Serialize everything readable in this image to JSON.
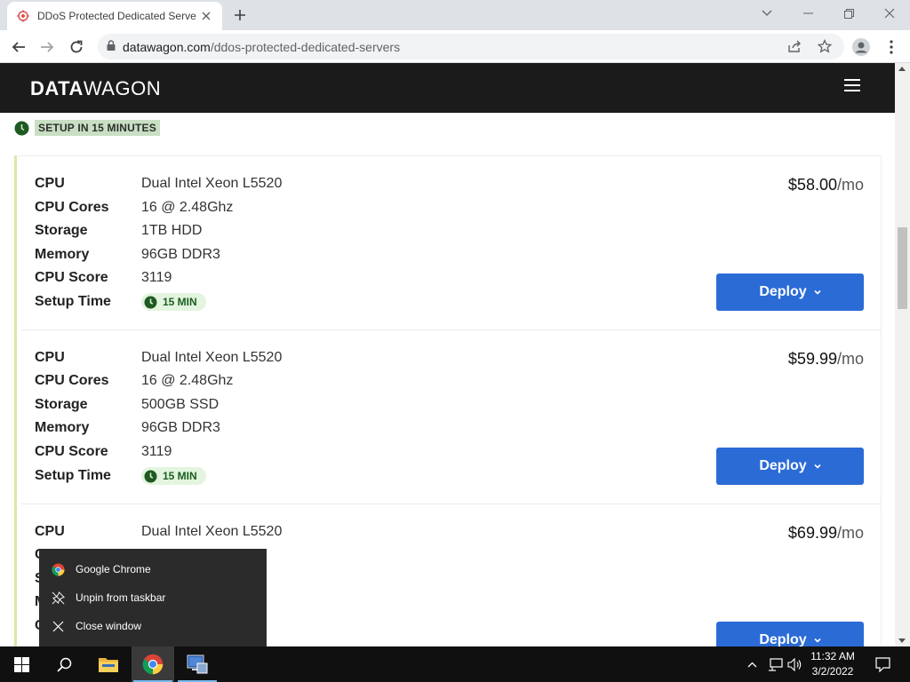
{
  "browser": {
    "tab_title": "DDoS Protected Dedicated Serve",
    "url_domain": "datawagon.com",
    "url_path": "/ddos-protected-dedicated-servers"
  },
  "site": {
    "logo_bold": "DATA",
    "logo_light": "WAGON",
    "setup_badge": "SETUP IN 15 MINUTES"
  },
  "labels": {
    "cpu": "CPU",
    "cores": "CPU Cores",
    "storage": "Storage",
    "memory": "Memory",
    "score": "CPU Score",
    "setup": "Setup Time",
    "deploy": "Deploy",
    "per_month": "/mo"
  },
  "servers": [
    {
      "cpu": "Dual Intel Xeon L5520",
      "cores": "16 @ 2.48Ghz",
      "storage": "1TB HDD",
      "memory": "96GB DDR3",
      "score": "3119",
      "setup": "15 MIN",
      "price": "$58.00"
    },
    {
      "cpu": "Dual Intel Xeon L5520",
      "cores": "16 @ 2.48Ghz",
      "storage": "500GB SSD",
      "memory": "96GB DDR3",
      "score": "3119",
      "setup": "15 MIN",
      "price": "$59.99"
    },
    {
      "cpu": "Dual Intel Xeon L5520",
      "price": "$69.99"
    }
  ],
  "context_menu": {
    "items": [
      {
        "label": "Google Chrome",
        "icon": "chrome-icon"
      },
      {
        "label": "Unpin from taskbar",
        "icon": "unpin-icon"
      },
      {
        "label": "Close window",
        "icon": "close-icon"
      }
    ]
  },
  "taskbar": {
    "time": "11:32 AM",
    "date": "3/2/2022"
  },
  "colors": {
    "accent": "#2b6bd6",
    "header": "#1b1b1b",
    "badge_green": "#1b5e20"
  }
}
